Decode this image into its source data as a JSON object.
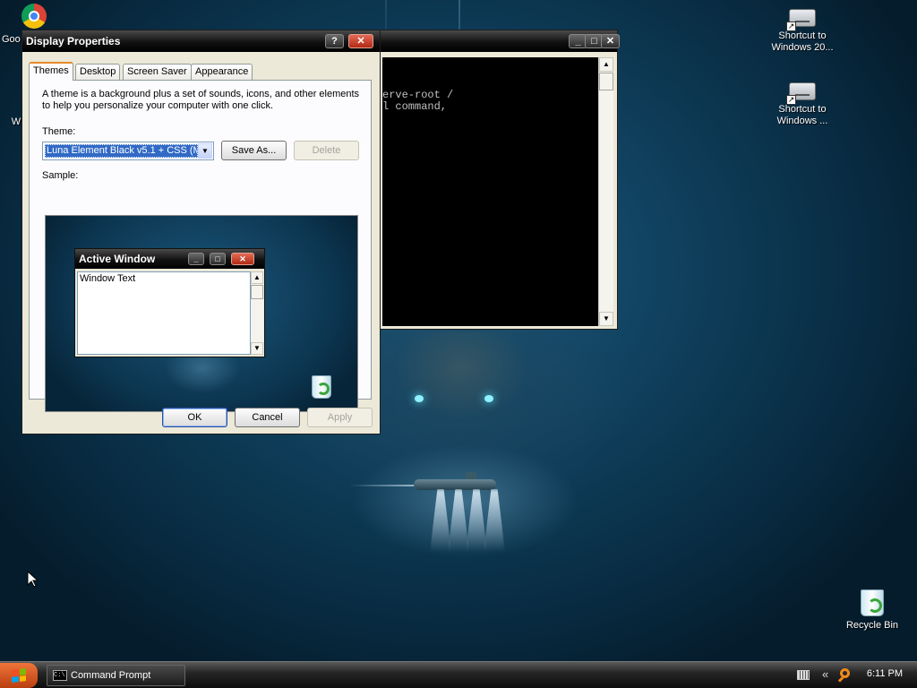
{
  "desktop": {
    "icons": [
      {
        "label": "Goo"
      },
      {
        "label": "Shortcut to Windows 20..."
      },
      {
        "label": "Shortcut to Windows ..."
      },
      {
        "label": "Recycle Bin"
      }
    ],
    "partial_letter": "W"
  },
  "cmd_window": {
    "lines": [
      "erve-root /",
      "l command,"
    ]
  },
  "display_properties": {
    "title": "Display Properties",
    "help_button": "?",
    "close_button": "✕",
    "tabs": [
      {
        "label": "Themes",
        "active": true
      },
      {
        "label": "Desktop"
      },
      {
        "label": "Screen Saver"
      },
      {
        "label": "Appearance"
      }
    ],
    "description": "A theme is a background plus a set of sounds, icons, and other elements to help you personalize your computer with one click.",
    "theme_label": "Theme:",
    "theme_value": "Luna Element Black v5.1 + CSS (M",
    "save_as": "Save As...",
    "delete": "Delete",
    "sample_label": "Sample:",
    "sample_window_title": "Active Window",
    "sample_window_text": "Window Text",
    "ok": "OK",
    "cancel": "Cancel",
    "apply": "Apply"
  },
  "taskbar": {
    "task_label": "Command Prompt",
    "task_icon_text": "C:\\",
    "tray_chevron": "«",
    "clock": "6:11 PM"
  },
  "colors": {
    "start_button": "#d85a20",
    "title_bar": "#111111",
    "close_button": "#c8391f"
  }
}
